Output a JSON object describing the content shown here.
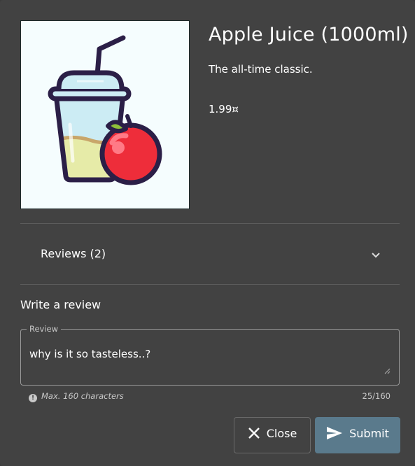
{
  "product": {
    "title": "Apple Juice (1000ml)",
    "description": "The all-time classic.",
    "price": "1.99¤"
  },
  "reviews": {
    "header_label": "Reviews (2)"
  },
  "review_form": {
    "section_title": "Write a review",
    "field_label": "Review",
    "field_value": "why is it so tasteless..?",
    "hint": "Max. 160 characters",
    "counter": "25/160"
  },
  "buttons": {
    "close_label": "Close",
    "submit_label": "Submit"
  },
  "colors": {
    "dialog_bg": "#424242",
    "submit_bg": "#5a7a8c",
    "divider": "#5c5c5c"
  },
  "icons": {
    "product": "apple-juice-icon",
    "chevron": "chevron-down-icon",
    "close": "close-icon",
    "submit": "send-icon",
    "hint": "exclamation-circle-icon"
  }
}
